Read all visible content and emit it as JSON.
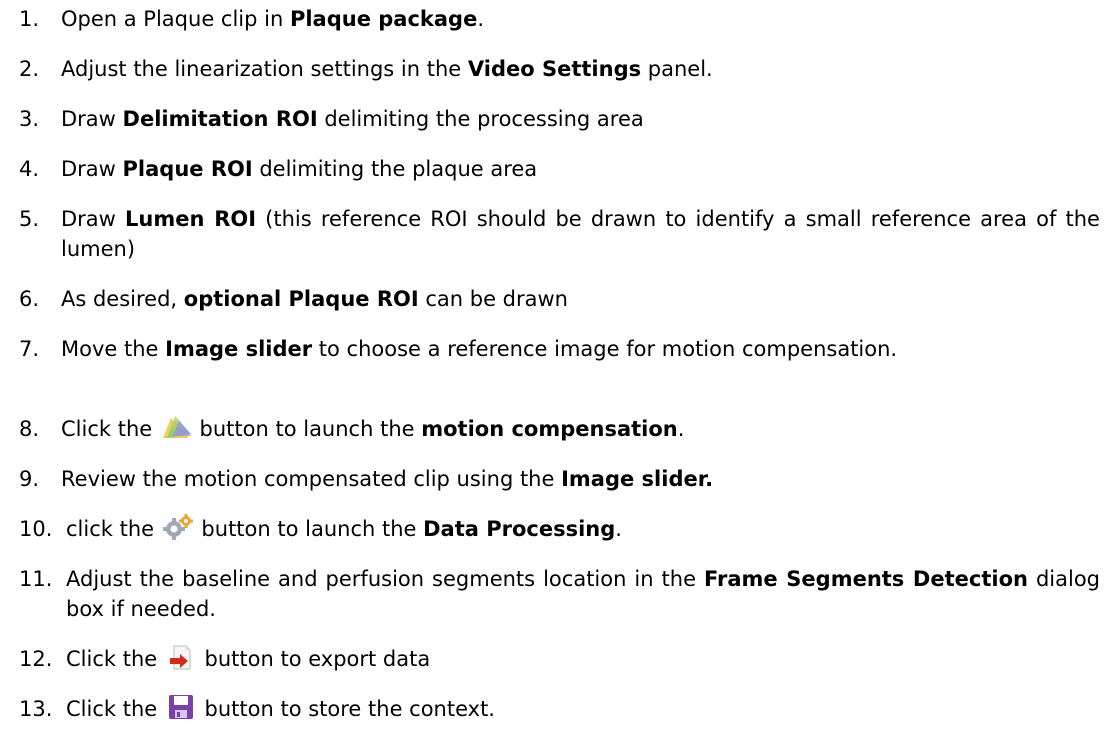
{
  "steps": [
    {
      "num": "1.",
      "a": "Open a Plaque clip in ",
      "b": "Plaque package",
      "c": "."
    },
    {
      "num": "2.",
      "a": "Adjust the linearization settings in the ",
      "b": "Video Settings",
      "c": " panel."
    },
    {
      "num": "3.",
      "a": "Draw ",
      "b": "Delimitation ROI",
      "c": " delimiting the processing area"
    },
    {
      "num": "4.",
      "a": "Draw ",
      "b": "Plaque ROI",
      "c": " delimiting the plaque area"
    },
    {
      "num": "5.",
      "a": "Draw ",
      "b": "Lumen ROI",
      "c": " (this reference ROI should be drawn to identify a small reference area of the lumen)"
    },
    {
      "num": "6.",
      "a": "As desired, ",
      "b": "optional Plaque ROI",
      "c": " can be drawn"
    },
    {
      "num": "7.",
      "a": "Move the ",
      "b": "Image slider",
      "c": " to choose a reference image for motion compensation."
    },
    {
      "num": "8.",
      "a": "Click the ",
      "icon": "motion-compensation-icon",
      "mid": " button to launch the ",
      "b": "motion compensation",
      "c": "."
    },
    {
      "num": "9.",
      "a": "Review the motion compensated clip using the ",
      "b": "Image slider.",
      "c": ""
    },
    {
      "num": "10.",
      "a": "click the ",
      "icon": "data-processing-gear-icon",
      "mid": " button to launch the ",
      "b": "Data Processing",
      "c": "."
    },
    {
      "num": "11.",
      "a": "Adjust the baseline and perfusion segments location in the ",
      "b": "Frame Segments Detection",
      "c": " dialog box if needed."
    },
    {
      "num": "12.",
      "a": "Click the ",
      "icon": "export-data-icon",
      "mid": " button to export data",
      "b": "",
      "c": ""
    },
    {
      "num": "13.",
      "a": "Click the ",
      "icon": "save-floppy-icon",
      "mid": " button to store the context.",
      "b": "",
      "c": ""
    }
  ],
  "colors": {
    "text": "#000000",
    "background": "#ffffff",
    "export_arrow": "#d42a1c",
    "save_floppy": "#7a3fa8"
  }
}
